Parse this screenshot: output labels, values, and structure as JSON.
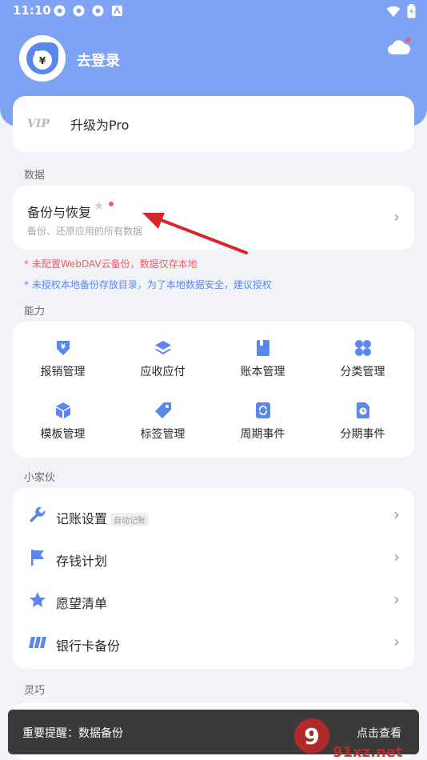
{
  "status_bar": {
    "time": "11:10"
  },
  "header": {
    "login_text": "去登录"
  },
  "pro": {
    "logo_text": "VIP",
    "label": "升级为Pro"
  },
  "data_section": {
    "title": "数据",
    "backup_title": "备份与恢复",
    "backup_subtitle": "备份、还原应用的所有数据",
    "warning_red": "* 未配置WebDAV云备份，数据仅存本地",
    "warning_blue": "* 未授权本地备份存放目录，为了本地数据安全，建议授权"
  },
  "ability_section": {
    "title": "能力",
    "items": [
      {
        "label": "报销管理",
        "icon": "reimburse-icon"
      },
      {
        "label": "应收应付",
        "icon": "layers-icon"
      },
      {
        "label": "账本管理",
        "icon": "book-icon"
      },
      {
        "label": "分类管理",
        "icon": "category-icon"
      },
      {
        "label": "模板管理",
        "icon": "template-icon"
      },
      {
        "label": "标签管理",
        "icon": "tag-icon"
      },
      {
        "label": "周期事件",
        "icon": "cycle-icon"
      },
      {
        "label": "分期事件",
        "icon": "installment-icon"
      }
    ]
  },
  "helper_section": {
    "title": "小家伙",
    "items": [
      {
        "label": "记账设置",
        "badge": "自动记账",
        "icon": "wrench-icon"
      },
      {
        "label": "存钱计划",
        "icon": "flag-icon"
      },
      {
        "label": "愿望清单",
        "icon": "star-icon"
      },
      {
        "label": "银行卡备份",
        "icon": "card-icon"
      }
    ]
  },
  "smart_section": {
    "title": "灵巧"
  },
  "toast": {
    "message": "重要提醒：数据备份",
    "action": "点击查看"
  },
  "watermark": {
    "text": "91xz.net"
  },
  "colors": {
    "accent": "#7ea3f4",
    "icon_blue": "#5b86ee",
    "warn_red": "#ef5d6a",
    "warn_blue": "#5b86ee"
  }
}
